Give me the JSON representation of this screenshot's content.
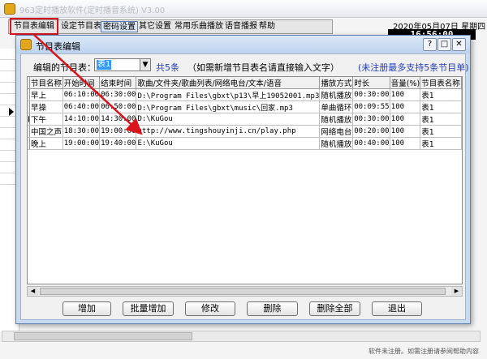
{
  "main_window": {
    "title": "963定时播放软件(定时播音系统) V3.00",
    "menu": [
      {
        "label": "节目表编辑",
        "active": false
      },
      {
        "label": "设定节目表",
        "active": false
      },
      {
        "label": "密码设置",
        "active": true
      },
      {
        "label": "其它设置",
        "active": false
      },
      {
        "label": "常用乐曲播放",
        "active": false
      },
      {
        "label": "语音播报",
        "active": false
      },
      {
        "label": "帮助",
        "active": false
      }
    ],
    "date": "2020年05月07日 星期四",
    "clock": "16:56:00",
    "status": "软件未注册。如需注册请参阅帮助内容"
  },
  "dialog": {
    "title": "节目表编辑",
    "table_label": "编辑的节目表：",
    "table_value": "表1",
    "count": "共5条",
    "hint": "（如需新增节目表名请直接输入文字）",
    "promo": "(未注册最多支持5条节目单)",
    "columns": [
      "节目名称",
      "开始时间",
      "结束时间",
      "歌曲/文件夹/歌曲列表/网络电台/文本/语音",
      "播放方式",
      "时长",
      "音量(%)",
      "节目表名称"
    ],
    "rows": [
      {
        "name": "早上",
        "start": "06:10:00",
        "end": "06:30:00",
        "source": "D:\\Program Files\\gbxt\\p13\\早上19052001.mp3",
        "mode": "随机播放",
        "duration": "00:30:00",
        "volume": "100",
        "table": "表1",
        "current": false
      },
      {
        "name": "早操",
        "start": "06:40:00",
        "end": "06:50:00",
        "source": "D:\\Program Files\\gbxt\\music\\回家.mp3",
        "mode": "单曲循环",
        "duration": "00:09:55",
        "volume": "100",
        "table": "表1",
        "current": false
      },
      {
        "name": "下午",
        "start": "14:10:00",
        "end": "14:30:00",
        "source": "D:\\KuGou",
        "mode": "随机播放",
        "duration": "00:30:00",
        "volume": "100",
        "table": "表1",
        "current": true
      },
      {
        "name": "中国之声",
        "start": "18:30:00",
        "end": "19:00:00",
        "source": "http://www.tingshouyinji.cn/play.php",
        "mode": "网络电台",
        "duration": "00:20:00",
        "volume": "100",
        "table": "表1",
        "current": false
      },
      {
        "name": "晚上",
        "start": "19:00:00",
        "end": "19:40:00",
        "source": "E:\\KuGou",
        "mode": "随机播放",
        "duration": "00:40:00",
        "volume": "100",
        "table": "表1",
        "current": false
      }
    ],
    "buttons": {
      "add": "增加",
      "batch_add": "批量增加",
      "modify": "修改",
      "delete": "删除",
      "delete_all": "删除全部",
      "exit": "退出"
    },
    "window_buttons": {
      "help": "?",
      "maximize": "□",
      "close": "✕"
    }
  },
  "colors": {
    "accent_blue": "#1f3db8",
    "highlight_red": "#d8141c",
    "selection_blue": "#3399ff"
  }
}
